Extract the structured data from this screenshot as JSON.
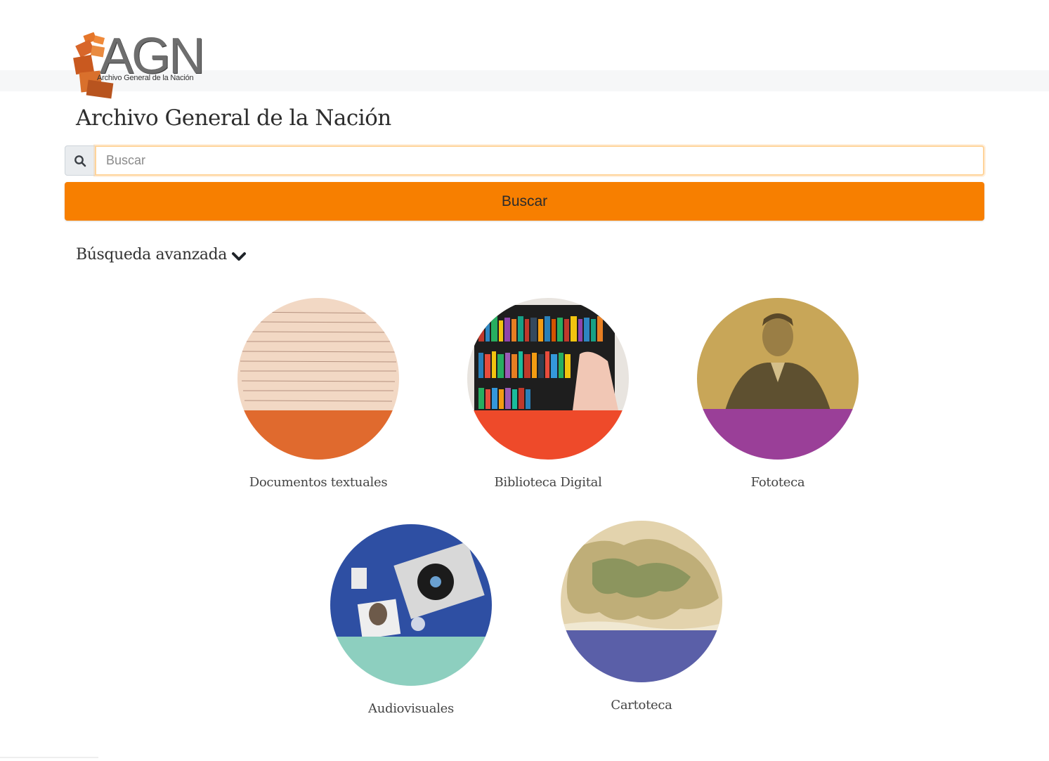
{
  "brand": {
    "logo_text": "AGN",
    "logo_subtitle": "Archivo General de la Nación"
  },
  "header": {
    "title": "Archivo General de la Nación"
  },
  "search": {
    "icon": "search-icon",
    "placeholder": "Buscar",
    "value": "",
    "button_label": "Buscar"
  },
  "advanced": {
    "label": "Búsqueda avanzada",
    "icon": "chevron-down-icon"
  },
  "collections": [
    {
      "label": "Documentos textuales",
      "band_color": "#e06a2e"
    },
    {
      "label": "Biblioteca Digital",
      "band_color": "#ee4a2a"
    },
    {
      "label": "Fototeca",
      "band_color": "#9a3f98"
    },
    {
      "label": "Audiovisuales",
      "band_color": "#8dcfbf"
    },
    {
      "label": "Cartoteca",
      "band_color": "#5a5fa8"
    }
  ],
  "colors": {
    "accent": "#f77f00",
    "title_text": "#2d2d2d",
    "logo_orange": "#e5762a"
  }
}
